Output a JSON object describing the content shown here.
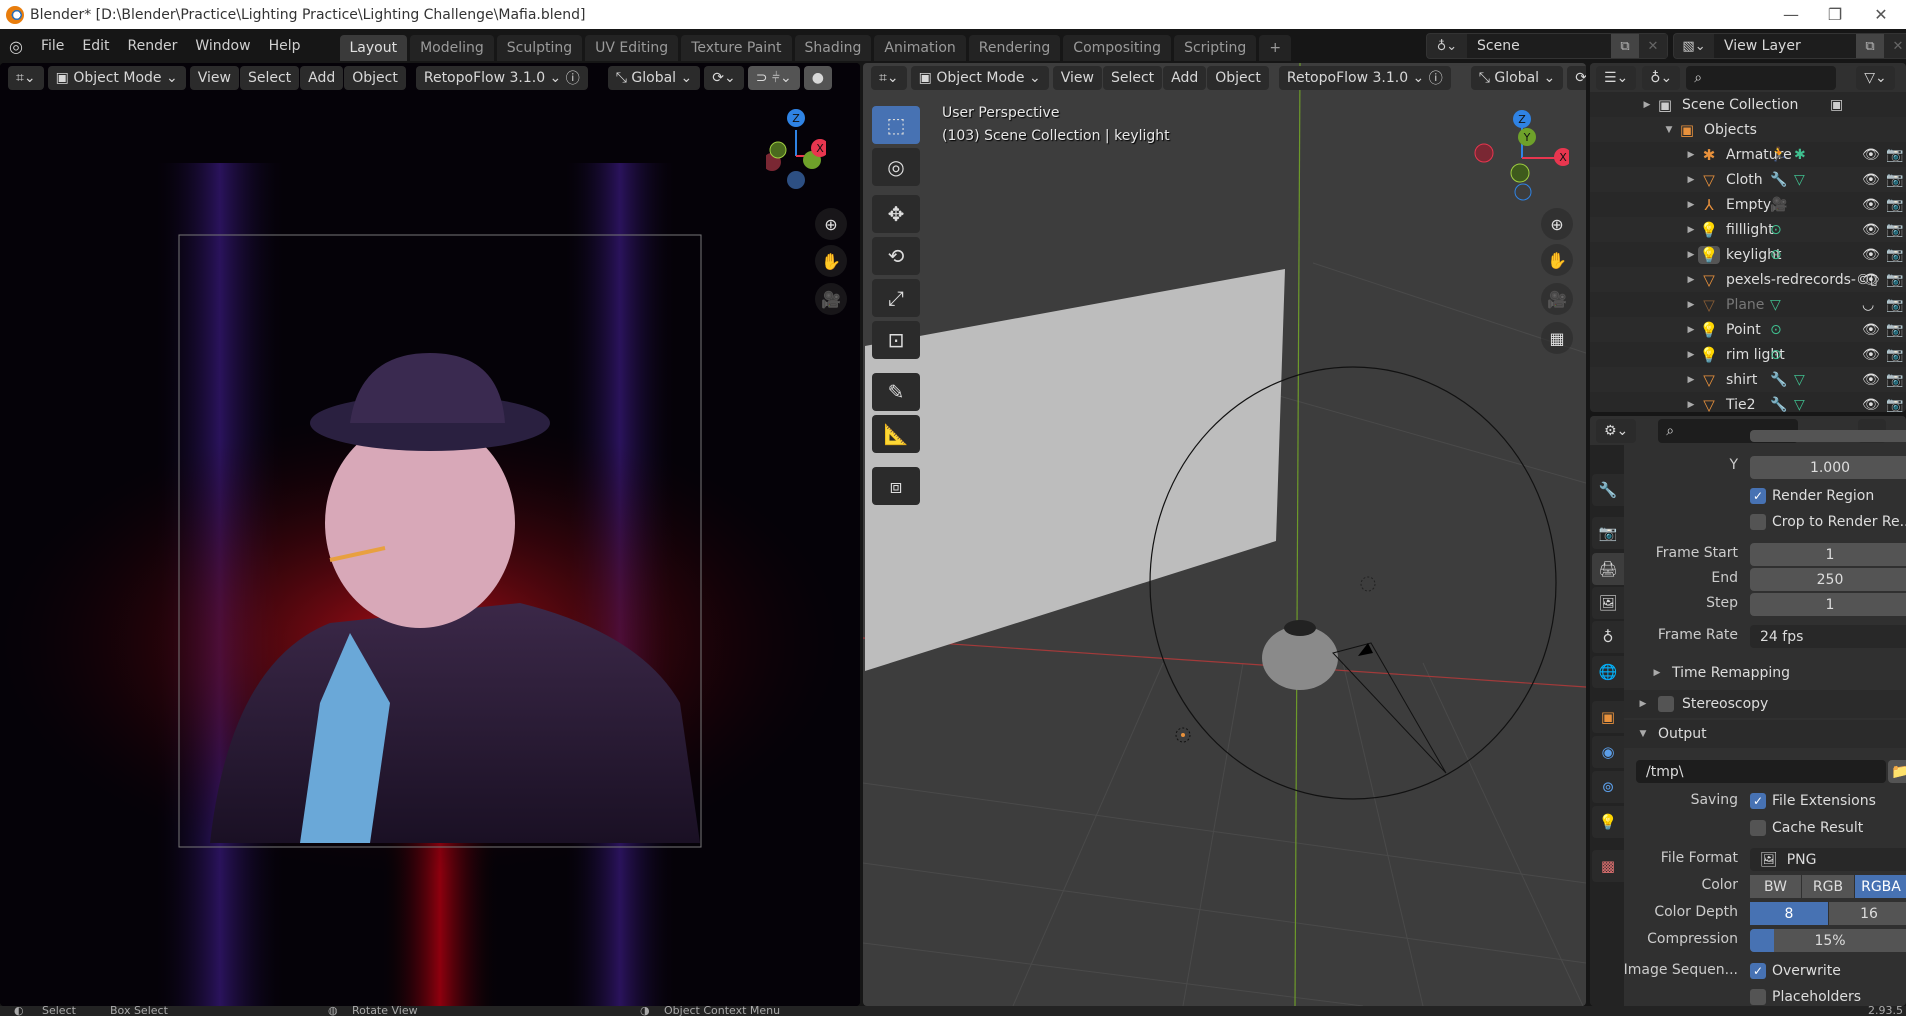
{
  "window": {
    "title": "Blender* [D:\\Blender\\Practice\\Lighting Practice\\Lighting Challenge\\Mafia.blend]",
    "minimize": "—",
    "maximize": "❐",
    "close": "✕"
  },
  "menu": [
    "File",
    "Edit",
    "Render",
    "Window",
    "Help"
  ],
  "workspaces": [
    "Layout",
    "Modeling",
    "Sculpting",
    "UV Editing",
    "Texture Paint",
    "Shading",
    "Animation",
    "Rendering",
    "Compositing",
    "Scripting",
    "+"
  ],
  "active_workspace": "Layout",
  "scene": {
    "name": "Scene"
  },
  "view_layer": {
    "name": "View Layer"
  },
  "viewport_header": {
    "mode": "Object Mode",
    "view": "View",
    "select": "Select",
    "add": "Add",
    "object": "Object",
    "addon": "RetopoFlow 3.1.0",
    "orientation": "Global"
  },
  "viewport3d": {
    "perspective": "User Perspective",
    "context": "(103) Scene Collection | keylight"
  },
  "gizmo": {
    "x": "X",
    "y": "Y",
    "z": "Z",
    "colors": {
      "x": "#e8364f",
      "y": "#6ea12a",
      "z": "#2f83e4"
    }
  },
  "outliner": {
    "rows": [
      {
        "name": "Scene Collection",
        "icon": "collection-icon",
        "level": 0
      },
      {
        "name": "Objects",
        "icon": "collection-icon",
        "level": 1,
        "expanded": true
      },
      {
        "name": "Armature",
        "icon": "armature-icon",
        "level": 2,
        "mods": [
          "pose-icon",
          "armature-data-icon"
        ]
      },
      {
        "name": "Cloth",
        "icon": "mesh-icon",
        "level": 2,
        "mods": [
          "wrench-icon",
          "mesh-data-icon"
        ]
      },
      {
        "name": "Empty",
        "icon": "empty-icon",
        "level": 2,
        "mods": [
          "camera-icon"
        ]
      },
      {
        "name": "filllight",
        "icon": "light-icon",
        "level": 2,
        "mods": [
          "light-data-icon"
        ]
      },
      {
        "name": "keylight",
        "icon": "light-icon",
        "level": 2,
        "mods": [
          "light-data-icon"
        ],
        "active": true
      },
      {
        "name": "pexels-redrecords-©▯",
        "icon": "mesh-icon",
        "level": 2,
        "mods": []
      },
      {
        "name": "Plane",
        "icon": "mesh-icon",
        "level": 2,
        "mods": [
          "mesh-data-icon"
        ],
        "hidden": true
      },
      {
        "name": "Point",
        "icon": "light-icon",
        "level": 2,
        "mods": [
          "light-data-icon"
        ]
      },
      {
        "name": "rim light",
        "icon": "light-icon",
        "level": 2,
        "mods": [
          "light-data-icon"
        ]
      },
      {
        "name": "shirt",
        "icon": "mesh-icon",
        "level": 2,
        "mods": [
          "wrench-icon",
          "mesh-data-icon"
        ]
      },
      {
        "name": "Tie2",
        "icon": "mesh-icon",
        "level": 2,
        "mods": [
          "wrench-icon",
          "mesh-data-icon"
        ]
      }
    ]
  },
  "properties": {
    "aspect_y_label": "Y",
    "aspect_y": "1.000",
    "render_region": {
      "label": "Render Region",
      "checked": true
    },
    "crop_region": {
      "label": "Crop to Render Re...",
      "checked": false
    },
    "frame_start_label": "Frame Start",
    "frame_start": "1",
    "frame_end_label": "End",
    "frame_end": "250",
    "frame_step_label": "Step",
    "frame_step": "1",
    "frame_rate_label": "Frame Rate",
    "frame_rate": "24 fps",
    "time_remapping": "Time Remapping",
    "stereoscopy": "Stereoscopy",
    "output": "Output",
    "output_path": "/tmp\\",
    "saving_label": "Saving",
    "file_extensions": {
      "label": "File Extensions",
      "checked": true
    },
    "cache_result": {
      "label": "Cache Result",
      "checked": false
    },
    "file_format_label": "File Format",
    "file_format": "PNG",
    "color_label": "Color",
    "color_options": [
      "BW",
      "RGB",
      "RGBA"
    ],
    "color_selected": "RGBA",
    "color_depth_label": "Color Depth",
    "color_depth_options": [
      "8",
      "16"
    ],
    "color_depth_selected": "8",
    "compression_label": "Compression",
    "compression": "15%",
    "compression_value": 15,
    "image_sequence_label": "Image Sequen...",
    "overwrite": {
      "label": "Overwrite",
      "checked": true
    },
    "placeholders": {
      "label": "Placeholders",
      "checked": false
    },
    "accent": "#4772b3"
  },
  "statusbar": {
    "select": "Select",
    "box_select": "Box Select",
    "rotate": "Rotate View",
    "context_menu": "Object Context Menu",
    "version": "2.93.5"
  }
}
